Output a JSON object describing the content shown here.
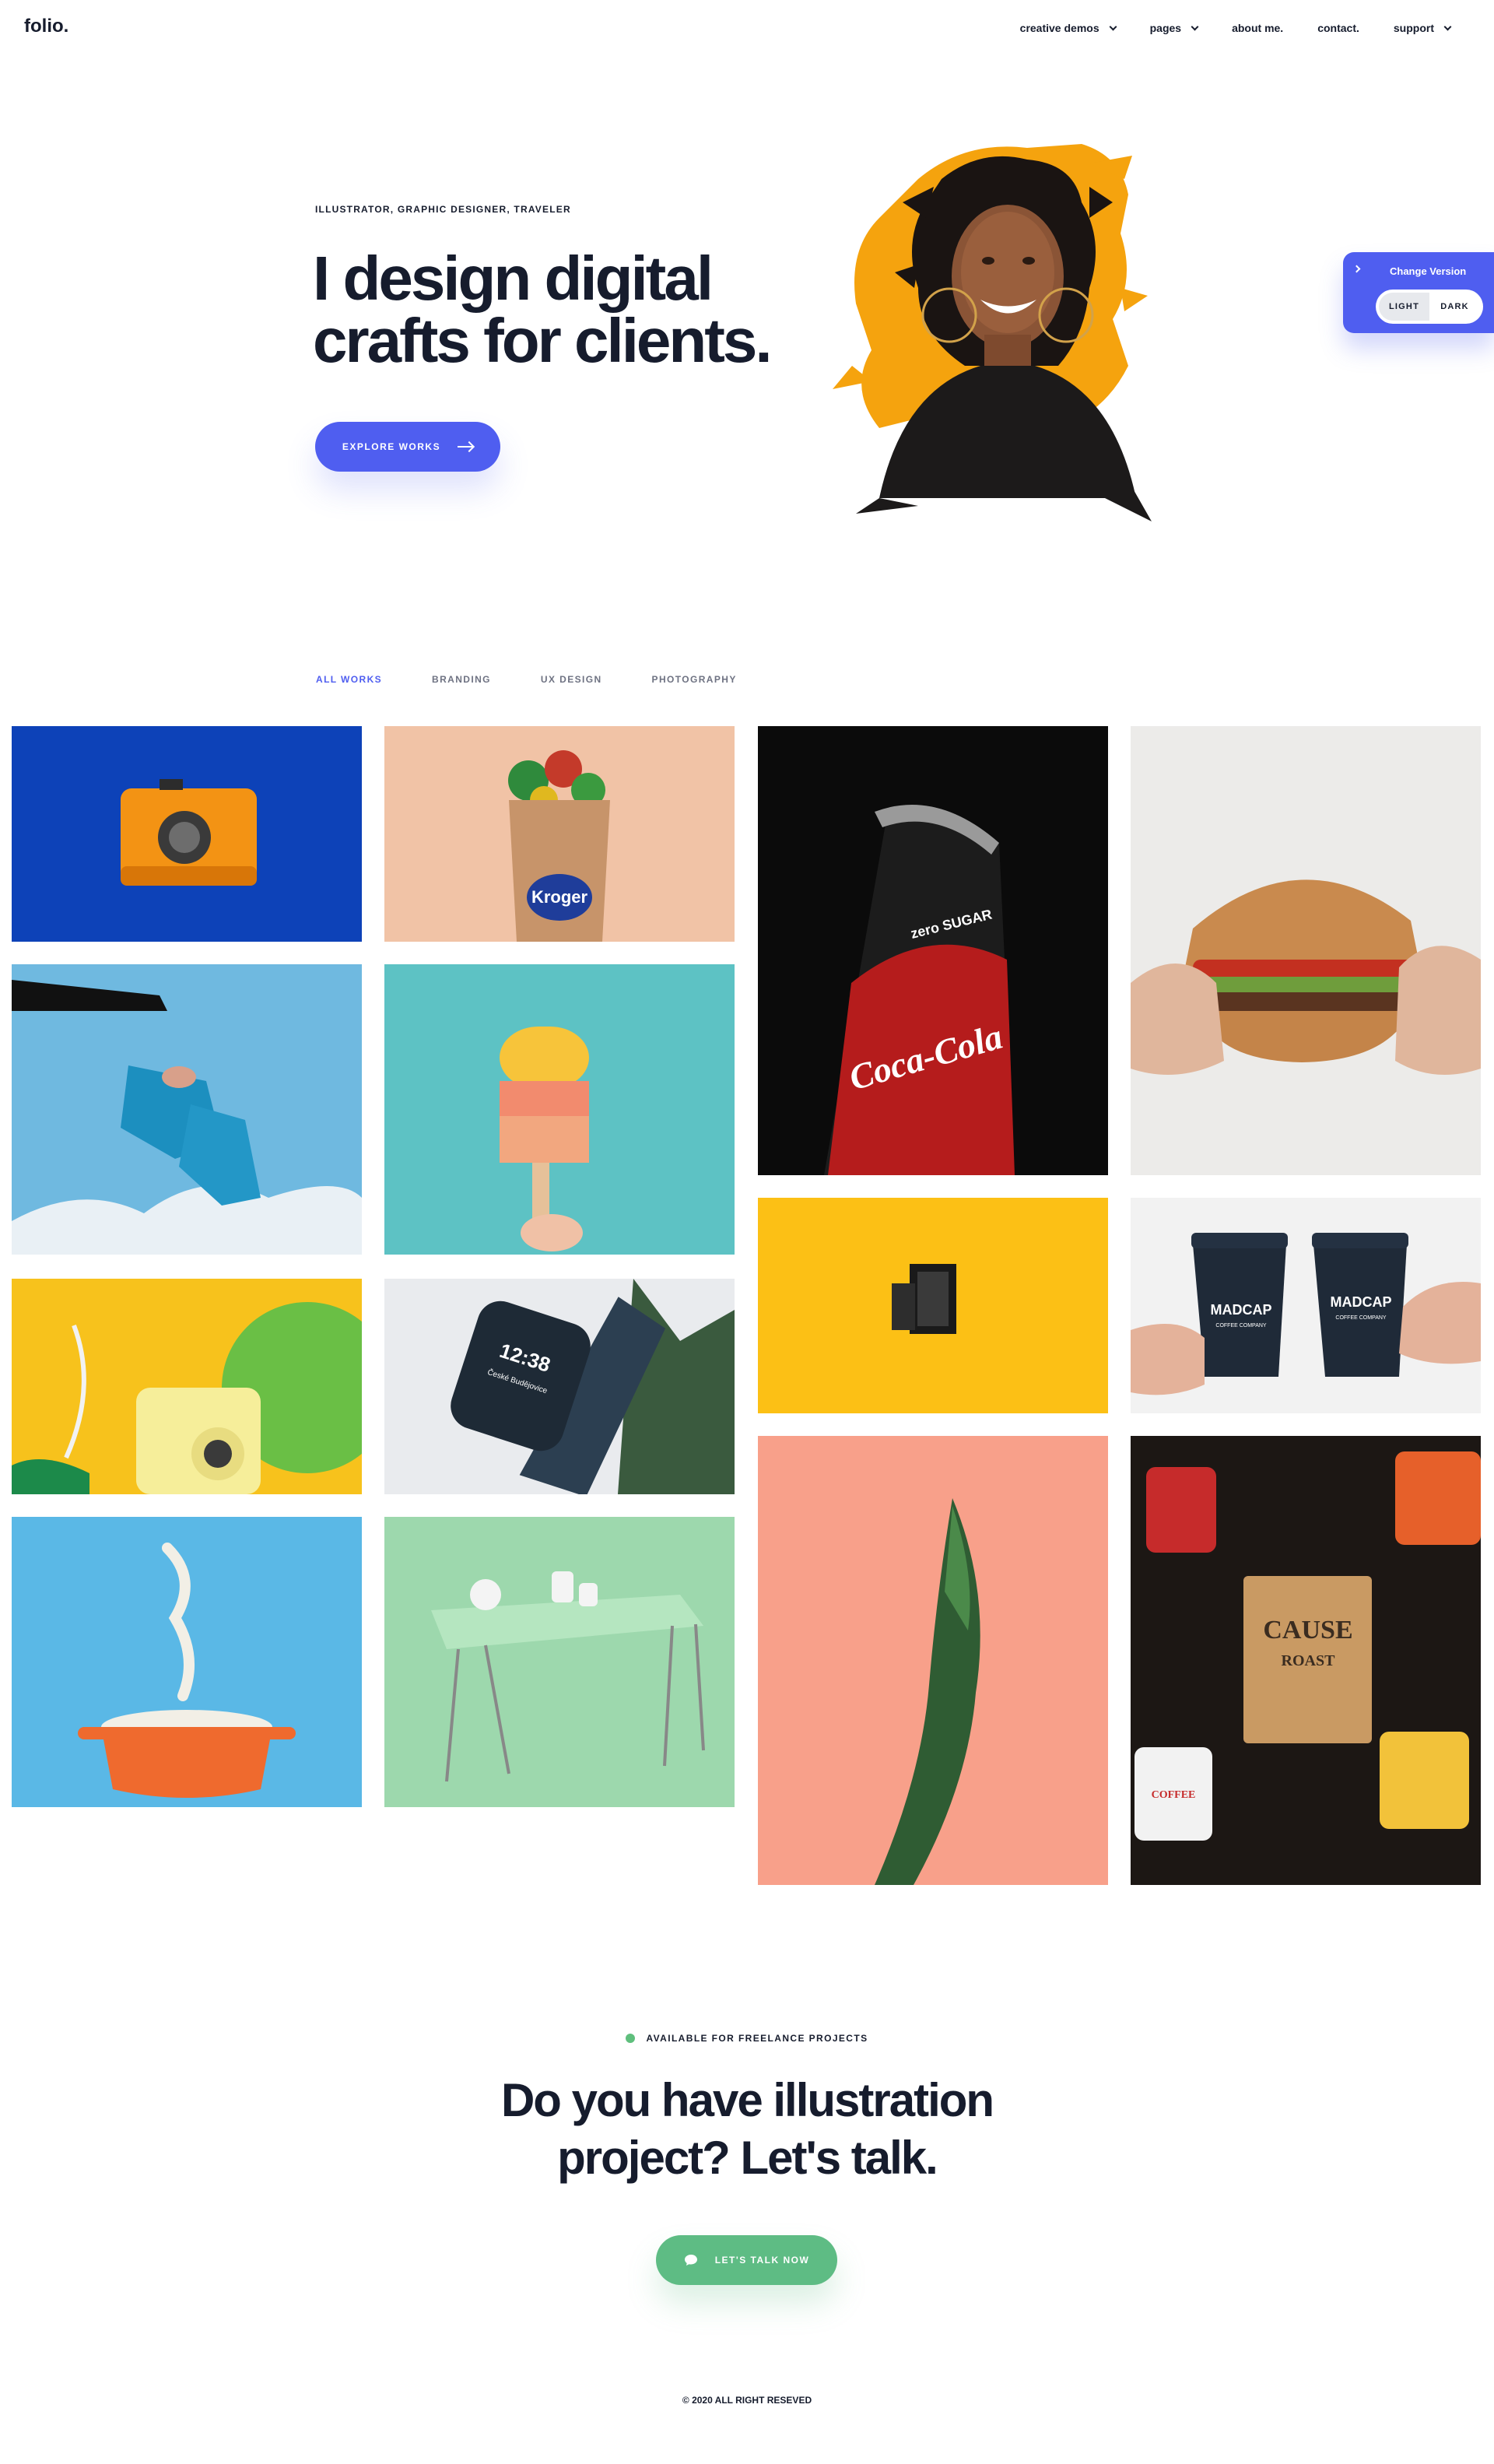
{
  "brand": {
    "logo": "folio."
  },
  "nav": {
    "items": [
      {
        "label": "creative demos",
        "dropdown": true
      },
      {
        "label": "pages",
        "dropdown": true
      },
      {
        "label": "about me.",
        "dropdown": false
      },
      {
        "label": "contact.",
        "dropdown": false
      },
      {
        "label": "support",
        "dropdown": true
      }
    ]
  },
  "hero": {
    "eyebrow": "ILLUSTRATOR, GRAPHIC DESIGNER, TRAVELER",
    "title_line1": "I design digital",
    "title_line2": "crafts for clients.",
    "cta_label": "EXPLORE WORKS"
  },
  "version_switcher": {
    "title": "Change Version",
    "options": [
      "LIGHT",
      "DARK"
    ],
    "selected": "LIGHT"
  },
  "filters": {
    "items": [
      "ALL WORKS",
      "BRANDING",
      "UX DESIGN",
      "PHOTOGRAPHY"
    ],
    "active": "ALL WORKS"
  },
  "gallery": {
    "items": [
      {
        "subject": "orange camera on blue"
      },
      {
        "subject": "Kroger grocery bag"
      },
      {
        "subject": "Coca-Cola zero sugar can"
      },
      {
        "subject": "burger held in hands"
      },
      {
        "subject": "sneakers in the sky"
      },
      {
        "subject": "popsicle on teal"
      },
      {
        "subject": "film roll on yellow"
      },
      {
        "subject": "MADCAP coffee cups"
      },
      {
        "subject": "instant camera with leaves"
      },
      {
        "subject": "smartwatch with plant"
      },
      {
        "subject": "pink wall with plant"
      },
      {
        "subject": "CAUSE coffee roast and mugs"
      },
      {
        "subject": "noodles in red pot"
      },
      {
        "subject": "green table with cups"
      }
    ],
    "text_on_images": {
      "kroger": "Kroger",
      "coke_brand": "Coca-Cola",
      "coke_variant": "zero SUGAR",
      "watch_time": "12:38",
      "watch_city": "České Budějovice",
      "madcap": "MADCAP",
      "madcap_sub": "COFFEE COMPANY",
      "cause": "CAUSE",
      "roast": "ROAST",
      "mug_text": "COFFEE"
    }
  },
  "cta": {
    "availability": "AVAILABLE FOR FREELANCE PROJECTS",
    "title_line1": "Do you have illustration",
    "title_line2": "project? Let's talk.",
    "button_label": "LET'S TALK NOW"
  },
  "footer": {
    "copyright": "© 2020 ALL RIGHT RESEVED"
  },
  "colors": {
    "primary": "#4f5ef0",
    "success": "#5ebc84",
    "text": "#161c2d",
    "muted": "#6e7282"
  }
}
